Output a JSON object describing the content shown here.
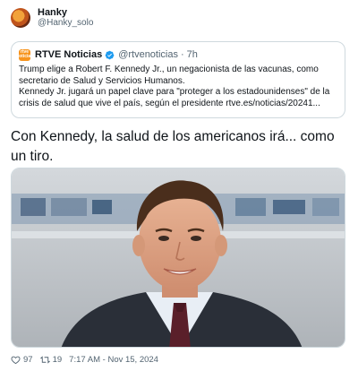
{
  "author": {
    "display_name": "Hanky",
    "handle": "@Hanky_solo",
    "avatar_icon": "avatar"
  },
  "quoted_tweet": {
    "account_name": "RTVE Noticias",
    "logo_text": "rtve noticias",
    "verified_icon": "verified-badge-icon",
    "handle": "@rtvenoticias",
    "separator": "·",
    "time": "7h",
    "text_line1": "Trump elige a Robert F. Kennedy Jr., un negacionista de las vacunas, como secretario de Salud y Servicios Humanos.",
    "text_line2": "Kennedy Jr. jugará un papel clave para \"proteger a los estadounidenses\" de la crisis de salud que vive el país, según el presidente rtve.es/noticias/20241..."
  },
  "tweet": {
    "text": "Con Kennedy, la salud de los americanos irá... como un tiro."
  },
  "media": {
    "description_icon": "news-anchor-photo",
    "colors": {
      "background_top": "#c8ccd0",
      "background_bottom": "#b9bdc2",
      "suit": "#2a2f38",
      "shirt": "#e8eef5",
      "tie": "#5a1f2a",
      "skin": "#e3a98a",
      "hair": "#4a2e1c"
    }
  },
  "footer": {
    "likes": "97",
    "retweets": "19",
    "timestamp": "7:17 AM - Nov 15, 2024"
  }
}
